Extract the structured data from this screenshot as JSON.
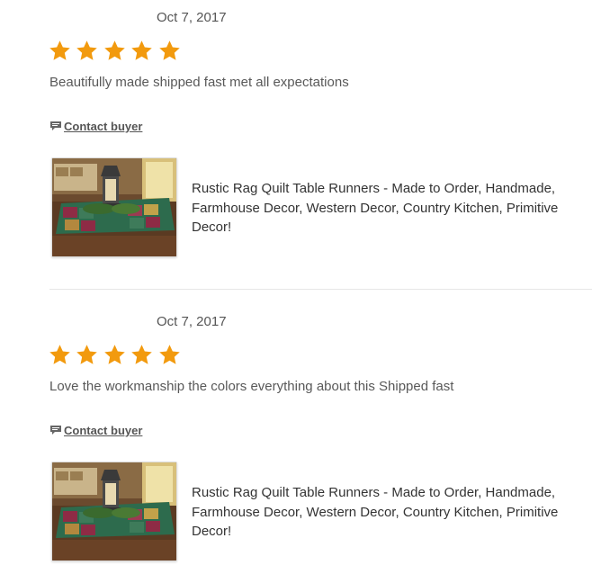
{
  "reviews": [
    {
      "date": "Oct 7, 2017",
      "rating": 5,
      "text": "Beautifully made shipped fast met all expectations",
      "contact_label": "Contact buyer",
      "listing_title": "Rustic Rag Quilt Table Runners - Made to Order, Handmade, Farmhouse Decor, Western Decor, Country Kitchen, Primitive Decor!"
    },
    {
      "date": "Oct 7, 2017",
      "rating": 5,
      "text": "Love the workmanship the colors everything about this Shipped fast",
      "contact_label": "Contact buyer",
      "listing_title": "Rustic Rag Quilt Table Runners - Made to Order, Handmade, Farmhouse Decor, Western Decor, Country Kitchen, Primitive Decor!"
    }
  ],
  "colors": {
    "star": "#F29A0E",
    "link": "#555555",
    "divider": "#E6E6E6"
  },
  "icons": {
    "star": "star-icon",
    "contact": "speech-bubble-icon"
  }
}
